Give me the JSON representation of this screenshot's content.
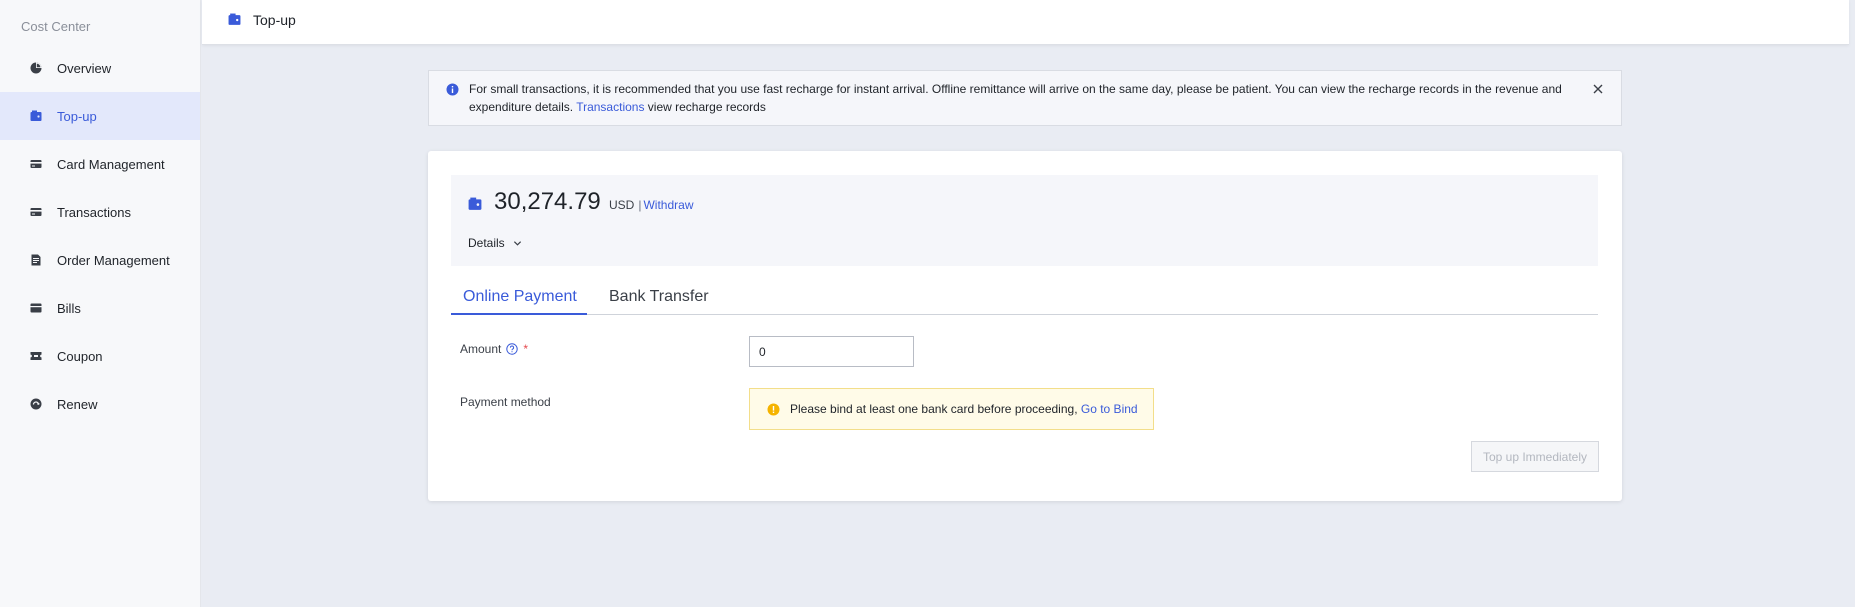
{
  "sidebar": {
    "title": "Cost Center",
    "items": [
      {
        "label": "Overview",
        "icon": "pie-chart-icon"
      },
      {
        "label": "Top-up",
        "icon": "wallet-icon"
      },
      {
        "label": "Card Management",
        "icon": "card-icon"
      },
      {
        "label": "Transactions",
        "icon": "card-icon"
      },
      {
        "label": "Order Management",
        "icon": "document-icon"
      },
      {
        "label": "Bills",
        "icon": "bill-icon"
      },
      {
        "label": "Coupon",
        "icon": "coupon-icon"
      },
      {
        "label": "Renew",
        "icon": "renew-icon"
      }
    ],
    "active_index": 1
  },
  "header": {
    "title": "Top-up",
    "icon": "wallet-icon"
  },
  "notice": {
    "text": "For small transactions, it is recommended that you use fast recharge for instant arrival. Offline remittance will arrive on the same day, please be patient. You can view the recharge records in the revenue and expenditure details.",
    "link_label": "Transactions",
    "suffix": "view recharge records"
  },
  "balance": {
    "amount": "30,274.79",
    "currency": "USD",
    "separator": "|",
    "withdraw_label": "Withdraw",
    "details_label": "Details"
  },
  "tabs": [
    {
      "label": "Online Payment",
      "active": true
    },
    {
      "label": "Bank Transfer",
      "active": false
    }
  ],
  "form": {
    "amount_label": "Amount",
    "required_mark": "*",
    "amount_value": "0",
    "payment_method_label": "Payment method",
    "warning_text": "Please bind at least one bank card before proceeding,",
    "warning_link": "Go to Bind",
    "submit_label": "Top up Immediately"
  },
  "colors": {
    "accent": "#3a5bd9",
    "warning": "#f5b300",
    "required": "#e5484d"
  }
}
